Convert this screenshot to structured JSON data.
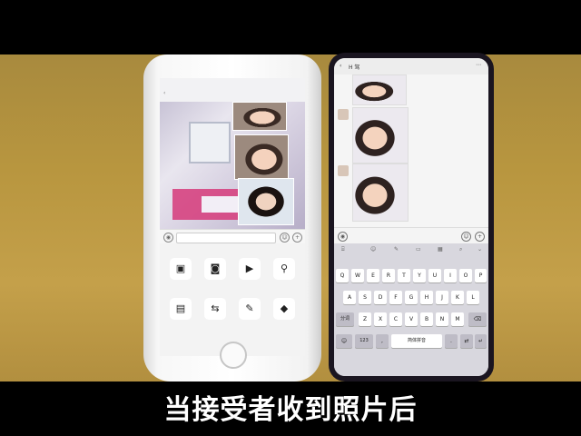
{
  "subtitle": "当接受者收到照片后",
  "left_phone": {
    "icons": [
      "photo-icon",
      "camera-icon",
      "video-call-icon",
      "location-icon",
      "wallet-icon",
      "transfer-icon",
      "voice-input-icon",
      "favorites-icon"
    ]
  },
  "right_phone": {
    "chat_title": "H 驾",
    "keyboard": {
      "row1": [
        "Q",
        "W",
        "E",
        "R",
        "T",
        "Y",
        "U",
        "I",
        "O",
        "P"
      ],
      "row2": [
        "A",
        "S",
        "D",
        "F",
        "G",
        "H",
        "J",
        "K",
        "L"
      ],
      "row3": [
        "Z",
        "X",
        "C",
        "V",
        "B",
        "N",
        "M"
      ],
      "shift_label": "分词",
      "numbers_label": "123",
      "space_label": "简体拼音"
    }
  }
}
